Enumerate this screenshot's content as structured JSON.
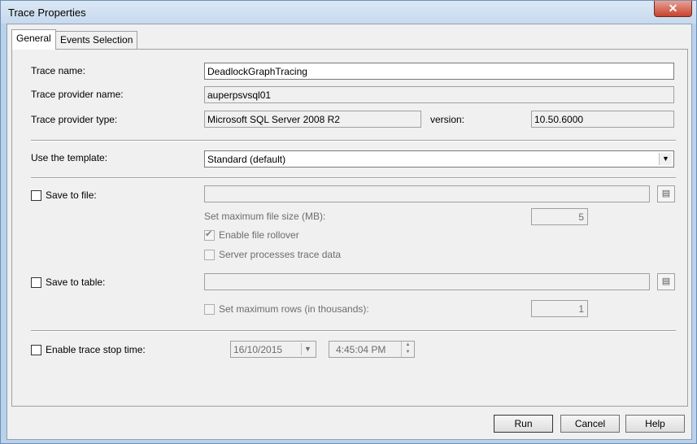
{
  "window": {
    "title": "Trace Properties",
    "close_glyph": "✕"
  },
  "tabs": [
    {
      "label": "General"
    },
    {
      "label": "Events Selection"
    }
  ],
  "general": {
    "trace_name_label": "Trace name:",
    "trace_name_value": "DeadlockGraphTracing",
    "provider_name_label": "Trace provider name:",
    "provider_name_value": "auperpsvsql01",
    "provider_type_label": "Trace provider type:",
    "provider_type_value": "Microsoft SQL Server 2008 R2",
    "version_label": "version:",
    "version_value": "10.50.6000",
    "template_label": "Use the template:",
    "template_value": "Standard (default)",
    "save_to_file_label": "Save to file:",
    "save_to_file_value": "",
    "max_file_size_label": "Set maximum file size (MB):",
    "max_file_size_value": "5",
    "enable_rollover_label": "Enable file rollover",
    "server_processes_label": "Server processes trace data",
    "save_to_table_label": "Save to table:",
    "save_to_table_value": "",
    "max_rows_label": "Set maximum rows (in thousands):",
    "max_rows_value": "1",
    "stop_time_label": "Enable trace stop time:",
    "stop_date_value": "16/10/2015",
    "stop_time_value": "4:45:04 PM"
  },
  "buttons": {
    "run": "Run",
    "cancel": "Cancel",
    "help": "Help"
  },
  "colors": {
    "title_bar": "#c6d9ee",
    "close_button": "#c7432f",
    "dialog_bg": "#f0f0f0"
  }
}
